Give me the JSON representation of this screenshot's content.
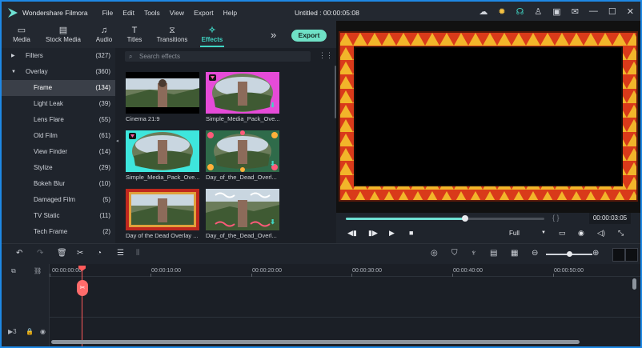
{
  "app": {
    "name": "Wondershare Filmora",
    "document_title": "Untitled : 00:00:05:08",
    "menu": [
      "File",
      "Edit",
      "Tools",
      "View",
      "Export",
      "Help"
    ],
    "accent": "#40d6c4"
  },
  "titlebar_icons": [
    "cloud-icon",
    "bulb-icon",
    "headset-icon",
    "account-icon",
    "save-icon",
    "mail-icon",
    "minimize-icon",
    "maximize-icon",
    "close-icon"
  ],
  "tabs": [
    {
      "label": "Media",
      "icon": "folder-icon"
    },
    {
      "label": "Stock Media",
      "icon": "cloud-folder-icon"
    },
    {
      "label": "Audio",
      "icon": "music-note-icon"
    },
    {
      "label": "Titles",
      "icon": "text-icon"
    },
    {
      "label": "Transitions",
      "icon": "transition-icon"
    },
    {
      "label": "Effects",
      "icon": "sparkle-icon",
      "active": true
    }
  ],
  "export_label": "Export",
  "categories": [
    {
      "label": "Filters",
      "count": "(327)",
      "expandable": true
    },
    {
      "label": "Overlay",
      "count": "(360)",
      "expanded": true
    },
    {
      "label": "Frame",
      "count": "(134)",
      "selected": true
    },
    {
      "label": "Light Leak",
      "count": "(39)"
    },
    {
      "label": "Lens Flare",
      "count": "(55)"
    },
    {
      "label": "Old Film",
      "count": "(61)"
    },
    {
      "label": "View Finder",
      "count": "(14)"
    },
    {
      "label": "Stylize",
      "count": "(29)"
    },
    {
      "label": "Bokeh Blur",
      "count": "(10)"
    },
    {
      "label": "Damaged Film",
      "count": "(5)"
    },
    {
      "label": "TV Static",
      "count": "(11)"
    },
    {
      "label": "Tech Frame",
      "count": "(2)"
    }
  ],
  "search": {
    "placeholder": "Search effects"
  },
  "effects": [
    {
      "name": "Cinema 21:9",
      "download": false,
      "premium": false,
      "style": "cinema"
    },
    {
      "name": "Simple_Media_Pack_Ove...",
      "download": true,
      "premium": true,
      "style": "magenta"
    },
    {
      "name": "Simple_Media_Pack_Ove...",
      "download": false,
      "premium": true,
      "style": "cyan"
    },
    {
      "name": "Day_of_the_Dead_Overl...",
      "download": true,
      "premium": false,
      "style": "flowers"
    },
    {
      "name": "Day of the Dead Overlay ...",
      "download": false,
      "premium": false,
      "style": "red"
    },
    {
      "name": "Day_of_the_Dead_Overl...",
      "download": true,
      "premium": false,
      "style": "swirls"
    }
  ],
  "preview": {
    "time": "00:00:03:05",
    "quality": "Full",
    "progress": 0.6,
    "brackets": "{    }"
  },
  "playback_buttons": [
    "step-back-icon",
    "play-frame-icon",
    "play-icon",
    "stop-icon"
  ],
  "timeline": {
    "ruler_labels": [
      "00:00:00:00",
      "00:00:10:00",
      "00:00:20:00",
      "00:00:30:00",
      "00:00:40:00",
      "00:00:50:00"
    ],
    "zoom_level": 0.5
  }
}
